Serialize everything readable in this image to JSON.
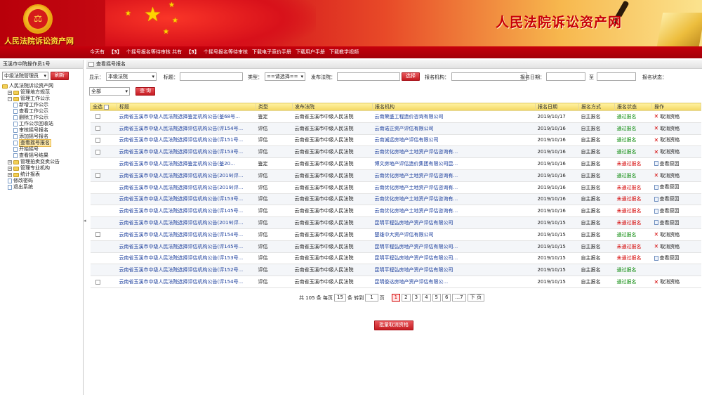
{
  "banner": {
    "brand": "人民法院诉讼资产网",
    "site_title": "人民法院诉讼资产网",
    "colors": {
      "primary": "#c8000a",
      "gold": "#ffd400"
    }
  },
  "nav": {
    "items": [
      {
        "text": "今天有",
        "hl": false
      },
      {
        "text": "【3】",
        "hl": true
      },
      {
        "text": "个摇号报名等待审核 共有",
        "hl": false
      },
      {
        "text": "【3】",
        "hl": true
      },
      {
        "text": "个摇号报名等待审核",
        "hl": false
      },
      {
        "text": "下载电子竞价手册",
        "hl": false
      },
      {
        "text": "下载用户手册",
        "hl": false
      },
      {
        "text": "下载教学视频",
        "hl": false
      }
    ]
  },
  "sidebar": {
    "user": "玉溪市中院操作员1号",
    "court_select": "中级法院管理员",
    "refresh_label": "刷新",
    "tree": [
      {
        "label": "人民法院诉讼资产网",
        "level": 0,
        "kind": "root"
      },
      {
        "label": "管理地方规范",
        "level": 1,
        "kind": "folder",
        "pm": "+"
      },
      {
        "label": "管理工作公示",
        "level": 1,
        "kind": "folder",
        "pm": "-"
      },
      {
        "label": "新增工作公示",
        "level": 2,
        "kind": "doc"
      },
      {
        "label": "查看工作公示",
        "level": 2,
        "kind": "doc"
      },
      {
        "label": "删除工作公示",
        "level": 2,
        "kind": "doc"
      },
      {
        "label": "工作公示回收站",
        "level": 2,
        "kind": "doc"
      },
      {
        "label": "审核摇号报名",
        "level": 2,
        "kind": "doc"
      },
      {
        "label": "添加摇号报名",
        "level": 2,
        "kind": "doc"
      },
      {
        "label": "查看摇号报名",
        "level": 2,
        "kind": "doc",
        "selected": true
      },
      {
        "label": "开始摇号",
        "level": 2,
        "kind": "doc"
      },
      {
        "label": "查看摇号结果",
        "level": 2,
        "kind": "doc"
      },
      {
        "label": "管理拍卖变卖公告",
        "level": 1,
        "kind": "folder",
        "pm": "+"
      },
      {
        "label": "管理专业机构",
        "level": 1,
        "kind": "folder",
        "pm": "+"
      },
      {
        "label": "统计报表",
        "level": 1,
        "kind": "folder",
        "pm": "+"
      },
      {
        "label": "修改密码",
        "level": 1,
        "kind": "doc"
      },
      {
        "label": "退出系统",
        "level": 1,
        "kind": "doc"
      }
    ]
  },
  "main": {
    "breadcrumb": "查看摇号报名",
    "filters": {
      "show_label": "显示：",
      "show_value": "本级法院",
      "title_label": "标题：",
      "type_label": "类型：",
      "type_value": "==请选择==",
      "court_label": "发布法院：",
      "choose_label": "选择",
      "org_label": "报名机构：",
      "date_label": "报名日期：",
      "to_label": "至",
      "status_label": "报名状态：",
      "status_value": "全部",
      "search_label": "查 询"
    },
    "table": {
      "headers": [
        "全选",
        "标题",
        "类型",
        "发布法院",
        "报名机构",
        "报名日期",
        "报名方式",
        "报名状态",
        "操作"
      ],
      "rows": [
        {
          "cb": true,
          "title": "云南省玉溪市中级人民法院选择鉴定机构公告(鉴68号...",
          "type": "鉴定",
          "court": "云南省玉溪市中级人民法院",
          "org": "云南荣盛工程造价咨询有限公司",
          "date": "2019/10/17",
          "method": "自主报名",
          "status": "通过报名",
          "ok": true,
          "action": "取消资格",
          "act": "x"
        },
        {
          "cb": true,
          "title": "云南省玉溪市中级人民法院选择评估机构公告(评154号...",
          "type": "评估",
          "court": "云南省玉溪市中级人民法院",
          "org": "云南诺正资产评估有限公司",
          "date": "2019/10/16",
          "method": "自主报名",
          "status": "通过报名",
          "ok": true,
          "action": "取消资格",
          "act": "x"
        },
        {
          "cb": true,
          "title": "云南省玉溪市中级人民法院选择评估机构公告(评151号...",
          "type": "评估",
          "court": "云南省玉溪市中级人民法院",
          "org": "云南诚远房地产评估有限公司",
          "date": "2019/10/16",
          "method": "自主报名",
          "status": "通过报名",
          "ok": true,
          "action": "取消资格",
          "act": "x"
        },
        {
          "cb": true,
          "title": "云南省玉溪市中级人民法院选择评估机构公告(评153号...",
          "type": "评估",
          "court": "云南省玉溪市中级人民法院",
          "org": "云南优化房地产土地资产评估咨询有...",
          "date": "2019/10/16",
          "method": "自主报名",
          "status": "通过报名",
          "ok": true,
          "action": "取消资格",
          "act": "x"
        },
        {
          "cb": false,
          "title": "云南省玉溪市中级人民法院选择鉴定机构公告(鉴20...",
          "type": "鉴定",
          "court": "云南省玉溪市中级人民法院",
          "org": "博文房地产评估造价集团有限公司昆...",
          "date": "2019/10/16",
          "method": "自主报名",
          "status": "未通过报名",
          "ok": false,
          "action": "查看原因",
          "act": "doc"
        },
        {
          "cb": true,
          "title": "云南省玉溪市中级人民法院选择评估机构公告(2019)评...",
          "type": "评估",
          "court": "云南省玉溪市中级人民法院",
          "org": "云南优化房地产土地资产评估咨询有...",
          "date": "2019/10/16",
          "method": "自主报名",
          "status": "通过报名",
          "ok": true,
          "action": "取消资格",
          "act": "x"
        },
        {
          "cb": false,
          "title": "云南省玉溪市中级人民法院选择评估机构公告(2019)评...",
          "type": "评估",
          "court": "云南省玉溪市中级人民法院",
          "org": "云南优化房地产土地资产评估咨询有...",
          "date": "2019/10/16",
          "method": "自主报名",
          "status": "未通过报名",
          "ok": false,
          "action": "查看原因",
          "act": "doc"
        },
        {
          "cb": false,
          "title": "云南省玉溪市中级人民法院选择评估机构公告(评153号...",
          "type": "评估",
          "court": "云南省玉溪市中级人民法院",
          "org": "云南优化房地产土地资产评估咨询有...",
          "date": "2019/10/16",
          "method": "自主报名",
          "status": "未通过报名",
          "ok": false,
          "action": "查看原因",
          "act": "doc"
        },
        {
          "cb": false,
          "title": "云南省玉溪市中级人民法院选择评估机构公告(评145号...",
          "type": "评估",
          "court": "云南省玉溪市中级人民法院",
          "org": "云南优化房地产土地资产评估咨询有...",
          "date": "2019/10/16",
          "method": "自主报名",
          "status": "未通过报名",
          "ok": false,
          "action": "查看原因",
          "act": "doc"
        },
        {
          "cb": false,
          "title": "云南省玉溪市中级人民法院选择评估机构公告(2019)评...",
          "type": "评估",
          "court": "云南省玉溪市中级人民法院",
          "org": "昆明平程弘房地产资产评估有限公司",
          "date": "2019/10/15",
          "method": "自主报名",
          "status": "未通过报名",
          "ok": false,
          "action": "查看原因",
          "act": "doc"
        },
        {
          "cb": true,
          "title": "云南省玉溪市中级人民法院选择评估机构公告(评154号...",
          "type": "评估",
          "court": "云南省玉溪市中级人民法院",
          "org": "楚雄中大资产评估有限公司",
          "date": "2019/10/15",
          "method": "自主报名",
          "status": "通过报名",
          "ok": true,
          "action": "取消资格",
          "act": "x"
        },
        {
          "cb": false,
          "title": "云南省玉溪市中级人民法院选择评估机构公告(评145号...",
          "type": "评估",
          "court": "云南省玉溪市中级人民法院",
          "org": "昆明平程弘房地产资产评估有限公司...",
          "date": "2019/10/15",
          "method": "自主报名",
          "status": "未通过报名",
          "ok": false,
          "action": "取消资格",
          "act": "x"
        },
        {
          "cb": false,
          "title": "云南省玉溪市中级人民法院选择评估机构公告(评153号...",
          "type": "评估",
          "court": "云南省玉溪市中级人民法院",
          "org": "昆明平程弘房地产资产评估有限公司...",
          "date": "2019/10/15",
          "method": "自主报名",
          "status": "未通过报名",
          "ok": false,
          "action": "查看原因",
          "act": "doc"
        },
        {
          "cb": false,
          "title": "云南省玉溪市中级人民法院选择评估机构公告(评152号...",
          "type": "评估",
          "court": "云南省玉溪市中级人民法院",
          "org": "昆明平程弘房地产资产评估有限公司",
          "date": "2019/10/15",
          "method": "自主报名",
          "status": "通过报名",
          "ok": true,
          "action": "",
          "act": "none"
        },
        {
          "cb": true,
          "title": "云南省玉溪市中级人民法院选择评估机构公告(评154号...",
          "type": "评估",
          "court": "云南省玉溪市中级人民法院",
          "org": "昆明俊达房地产资产评估有限公...",
          "date": "2019/10/15",
          "method": "自主报名",
          "status": "通过报名",
          "ok": true,
          "action": "取消资格",
          "act": "x"
        }
      ]
    },
    "pager": {
      "total_text": "共 105 条 每页",
      "per_page": "15",
      "goto_text": "条 转到",
      "page_input": "1",
      "page_unit": "页",
      "pages": [
        "1",
        "2",
        "3",
        "4",
        "5",
        "6",
        "...7"
      ],
      "current": "1",
      "next_label": "下 页"
    },
    "batch_cancel_label": "批量取消资格"
  }
}
